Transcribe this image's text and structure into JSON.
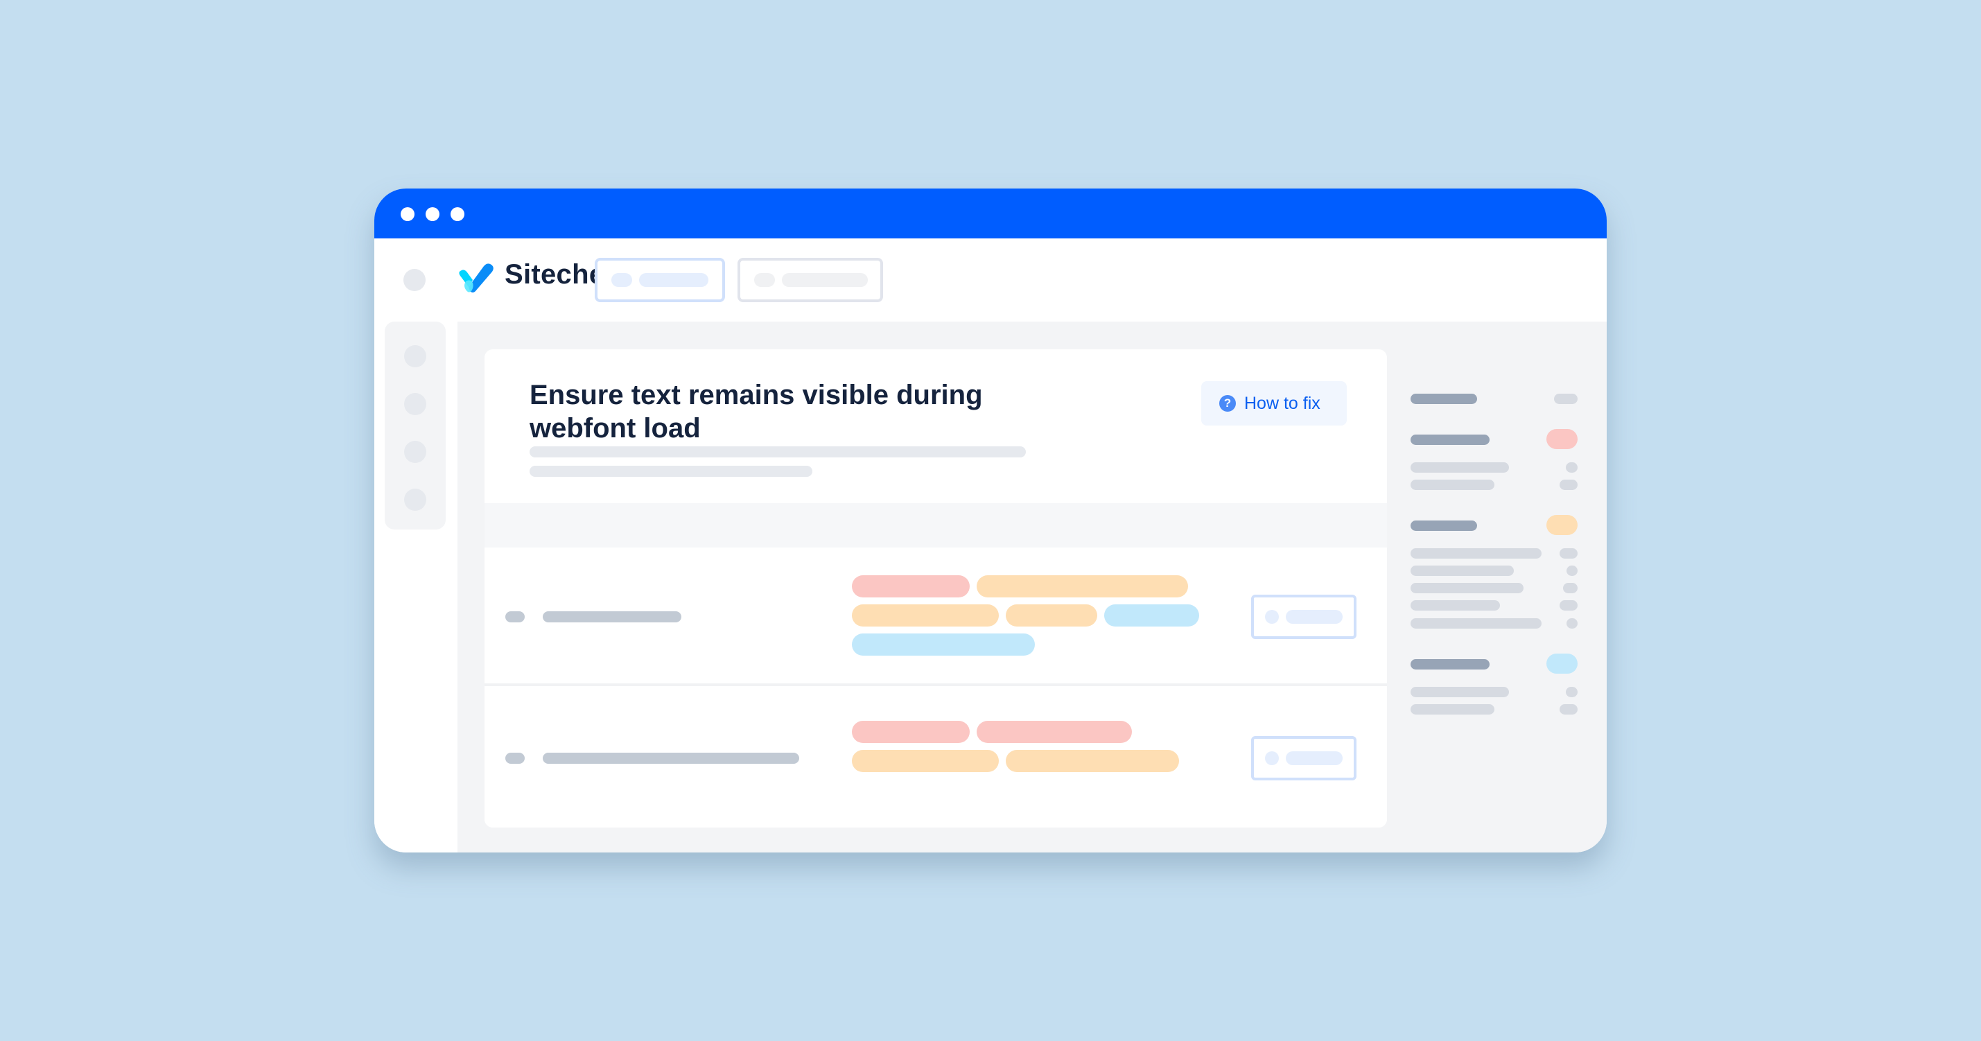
{
  "window": {
    "titlebar_color": "#005dff",
    "controls": [
      "window-dot",
      "window-dot",
      "window-dot"
    ]
  },
  "header": {
    "brand_name": "Sitechecker",
    "logo_icon": "checkmark-logo-icon",
    "buttons": [
      {
        "name": "header-button-primary",
        "style": "blue-outline"
      },
      {
        "name": "header-button-secondary",
        "style": "gray-outline"
      }
    ]
  },
  "sidebar": {
    "items": [
      "sidebar-item-1",
      "sidebar-item-2",
      "sidebar-item-3",
      "sidebar-item-4"
    ]
  },
  "main": {
    "title": "Ensure text remains visible during webfont load",
    "how_to_fix": {
      "label": "How to fix",
      "icon": "question-circle-icon",
      "icon_glyph": "?"
    },
    "rows": [
      {
        "tags": [
          [
            "red",
            "orange"
          ],
          [
            "orange",
            "orange",
            "blue"
          ],
          [
            "blue"
          ]
        ]
      },
      {
        "tags": [
          [
            "red",
            "red"
          ],
          [
            "orange",
            "orange"
          ]
        ]
      }
    ]
  },
  "right_panel": {
    "groups": [
      {
        "badge": null,
        "lines": 0
      },
      {
        "badge": "red",
        "lines": 2
      },
      {
        "badge": "orange",
        "lines": 5
      },
      {
        "badge": "blue",
        "lines": 2
      }
    ]
  },
  "colors": {
    "accent": "#005dff",
    "background": "#c4def0",
    "tag_red": "#fbc6c3",
    "tag_orange": "#fedeb3",
    "tag_blue": "#c1e8fb",
    "link_blue": "#0a5ff0",
    "title_text": "#15233d"
  }
}
